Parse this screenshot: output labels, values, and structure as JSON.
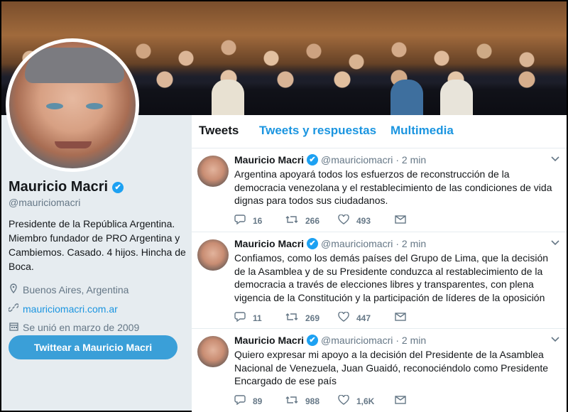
{
  "banner": {
    "alt": ""
  },
  "profile": {
    "name": "Mauricio Macri",
    "handle": "@mauriciomacri",
    "bio": "Presidente de la República Argentina. Miembro fundador de PRO Argentina y Cambiemos. Casado. 4 hijos. Hincha de Boca.",
    "location": "Buenos Aires, Argentina",
    "website": "mauriciomacri.com.ar",
    "joined": "Se unió en marzo de 2009",
    "tweet_to_label": "Twittear a Mauricio Macri"
  },
  "tabs": [
    {
      "label": "Tweets",
      "active": true
    },
    {
      "label": "Tweets y respuestas",
      "active": false
    },
    {
      "label": "Multimedia",
      "active": false
    }
  ],
  "tweets": [
    {
      "name": "Mauricio Macri",
      "handle": "@mauriciomacri",
      "time": "· 2 min",
      "text": "Argentina apoyará todos los esfuerzos de reconstrucción de la democracia venezolana y el restablecimiento de las condiciones de vida dignas para todos sus ciudadanos.",
      "replies": "16",
      "retweets": "266",
      "likes": "493"
    },
    {
      "name": "Mauricio Macri",
      "handle": "@mauriciomacri",
      "time": "· 2 min",
      "text": "Confiamos, como los demás países del Grupo de Lima, que la decisión de la Asamblea y de su Presidente conduzca al restablecimiento de la democracia a través de elecciones libres y transparentes, con plena vigencia de la Constitución y la participación de líderes de la oposición",
      "replies": "11",
      "retweets": "269",
      "likes": "447"
    },
    {
      "name": "Mauricio Macri",
      "handle": "@mauriciomacri",
      "time": "· 2 min",
      "text": "Quiero expresar mi apoyo a la decisión del Presidente de la Asamblea Nacional de Venezuela, Juan Guaidó, reconociéndolo como Presidente Encargado de ese país",
      "replies": "89",
      "retweets": "988",
      "likes": "1,6K"
    }
  ],
  "icons": {
    "verified": "✔",
    "location": "pin-icon",
    "link": "link-icon",
    "calendar": "calendar-icon",
    "reply": "reply-icon",
    "retweet": "retweet-icon",
    "like": "heart-icon",
    "message": "envelope-icon",
    "caret": "chevron-down-icon"
  },
  "colors": {
    "accent": "#1da1f2",
    "link": "#1b95e0",
    "button": "#3a9fd8"
  }
}
